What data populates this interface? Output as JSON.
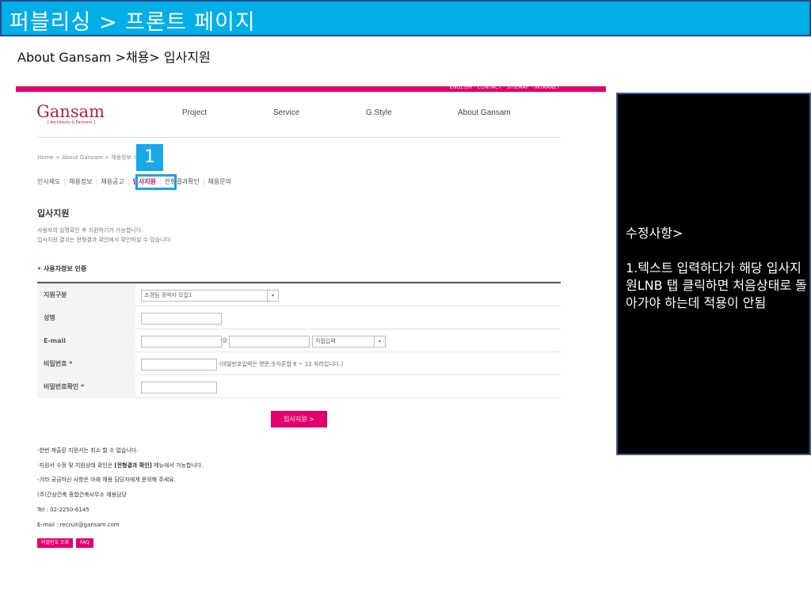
{
  "slide": {
    "title": "퍼블리싱 > 프론트 페이지",
    "breadcrumb": "About Gansam >채용> 입사지원"
  },
  "site": {
    "util_links": "ENGLISH · CONTACT · SITEMAP · INTRANET",
    "logo": "Gansam",
    "logo_sub": "[ Architects & Partners ]",
    "gnb": [
      "Project",
      "Service",
      "G.Style",
      "About Gansam"
    ],
    "crumb": "Home > About Gansam > 채용정보 > 입사지원",
    "marker": "1",
    "lnb": [
      "인사제도",
      "채용정보",
      "채용공고",
      "입사지원",
      "전형결과확인",
      "채용문의"
    ],
    "lnb_active_index": 3,
    "page_heading": "입사지원",
    "intro": [
      "사용자의 실명확인 후 지원하기가 가능합니다.",
      "입사지원 결과는 전형결과 확인에서 확인하실 수 있습니다."
    ],
    "section_title": "사용자정보 인증",
    "form": {
      "apply_type_label": "지원구분",
      "apply_type_value": "조경팀 경력자 모집1",
      "name_label": "성명",
      "email_label": "E-mail",
      "email_at": "@",
      "email_domain_value": "직접입력",
      "password_label": "비밀번호 *",
      "password_hint": "(비밀번호입력은 영문,숫자혼합 8 ~ 12 자리입니다.)",
      "password_confirm_label": "비밀번호확인 *"
    },
    "submit_label": "입사지원 >",
    "notes": {
      "n1": "-한번 제출된 지원서는 취소 할 수 없습니다.",
      "n2_pre": "-지원서 수정 및 지원상태 확인은 ",
      "n2_bold": "[전형결과 확인]",
      "n2_post": " 메뉴에서 가능합니다.",
      "n3": "-기타 궁금하신 사항은 아래 채용 담당자에게 문의해 주세요.",
      "n4": "(주)간삼건축 종합건축사무소 채용담당",
      "n5": "Tel : 02-2250-6145",
      "n6": "E-mail : recruit@gansam.com"
    },
    "buttons": [
      "비밀번호 조회",
      "FAQ"
    ]
  },
  "memo": {
    "title": "수정사항>",
    "body": "1.텍스트 입력하다가 해당 입사지원LNB 탭 클릭하면 처음상태로 돌아가야 하는데 적용이 안됨"
  },
  "colors": {
    "title_bar": "#00aee8",
    "brand_pink": "#e2006a",
    "highlight_blue": "#1aa3e8",
    "logo_red": "#b5213e"
  }
}
